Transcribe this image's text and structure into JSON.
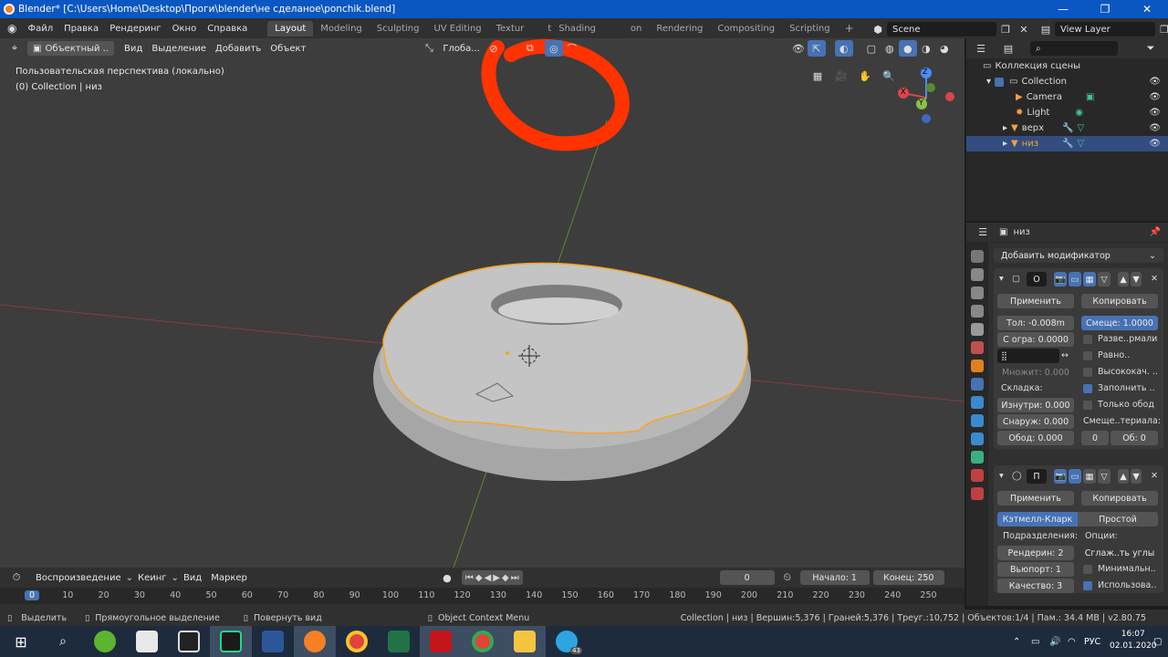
{
  "titlebar": {
    "title": "Blender* [C:\\Users\\Home\\Desktop\\Проги\\blender\\не сделаное\\ponchik.blend]",
    "min": "—",
    "max": "❐",
    "close": "✕"
  },
  "menu": [
    "Файл",
    "Правка",
    "Рендеринг",
    "Окно",
    "Справка"
  ],
  "workspaces": [
    "Layout",
    "Modeling",
    "Sculpting",
    "UV Editing",
    "Texture Paint",
    "Shading",
    "Animation",
    "Rendering",
    "Compositing",
    "Scripting"
  ],
  "workspaces_visible": [
    "Layout",
    "Modeling",
    "Sculpting",
    "UV Editing",
    "Textur",
    "t",
    "Shading",
    "on",
    "Rendering",
    "Compositing",
    "Scripting"
  ],
  "add_tab": "+",
  "scene": {
    "label": "Scene",
    "view_layer": "View Layer"
  },
  "viewport": {
    "mode": "Объектный ..",
    "menus": [
      "Вид",
      "Выделение",
      "Добавить",
      "Объект"
    ],
    "orientation": "Глоба...",
    "info_line1": "Пользовательская перспектива (локально)",
    "info_line2": "(0) Collection | низ",
    "gizmo": {
      "x": "X",
      "y": "Y",
      "z": "Z"
    }
  },
  "outliner": {
    "root": "Коллекция сцены",
    "items": [
      {
        "label": "Collection"
      },
      {
        "label": "Camera"
      },
      {
        "label": "Light"
      },
      {
        "label": "верх"
      },
      {
        "label": "низ"
      }
    ]
  },
  "properties": {
    "object_name": "низ",
    "add_modifier": "Добавить модификатор",
    "mod1": {
      "name": "О",
      "apply": "Применить",
      "copy": "Копировать",
      "thickness": "Тол: -0.008m",
      "offset": "Смеще: 1.0000",
      "clamp": "С огра: 0.0000",
      "flip": "Разве..рмали",
      "even": "Равно..",
      "high_quality": "Высококач. ..",
      "fill": "Заполнить ..",
      "rim_only": "Только обод",
      "factor": "Множит: 0.000",
      "crease": "Складка:",
      "inner": "Изнутри: 0.000",
      "outer": "Снаруж: 0.000",
      "rim": "Обод: 0.000",
      "mat_offset": "Смеще..териала:",
      "mat_val1": "0",
      "mat_val2": "Об: 0"
    },
    "mod2": {
      "name": "П",
      "apply": "Применить",
      "copy": "Копировать",
      "catmull": "Кэтмелл-Кларк",
      "simple": "Простой",
      "subdiv": "Подразделения:",
      "options": "Опции:",
      "render": "Рендерин: 2",
      "viewport": "Вьюпорт: 1",
      "quality": "Качество: 3",
      "smooth_corners": "Сглаж..ть углы",
      "minimal": "Минимальн..",
      "use": "Использова.."
    }
  },
  "timeline": {
    "menus": [
      "Воспроизведение",
      "Кеинг",
      "Вид",
      "Маркер"
    ],
    "current_frame": "0",
    "start": "Начало: 1",
    "end": "Конец: 250",
    "ticks": [
      "0",
      "10",
      "20",
      "30",
      "40",
      "50",
      "60",
      "70",
      "80",
      "90",
      "100",
      "110",
      "120",
      "130",
      "140",
      "150",
      "160",
      "170",
      "180",
      "190",
      "200",
      "210",
      "220",
      "230",
      "240",
      "250"
    ]
  },
  "statusbar": {
    "select": "Выделить",
    "box_select": "Прямоугольное выделение",
    "rotate": "Повернуть вид",
    "context_menu": "Object Context Menu",
    "stats": "Collection | низ | Вершин:5,376 | Граней:5,376 | Треуг.:10,752 | Объектов:1/4 | Пам.: 34.4 MB | v2.80.75"
  },
  "taskbar": {
    "lang": "РУС",
    "time": "16:07",
    "date": "02.01.2020",
    "badge": "43"
  },
  "colors": {
    "accent": "#4772b3",
    "selection": "#f5a623",
    "annotation": "#ff3300",
    "titlebar": "#0a57c2"
  }
}
